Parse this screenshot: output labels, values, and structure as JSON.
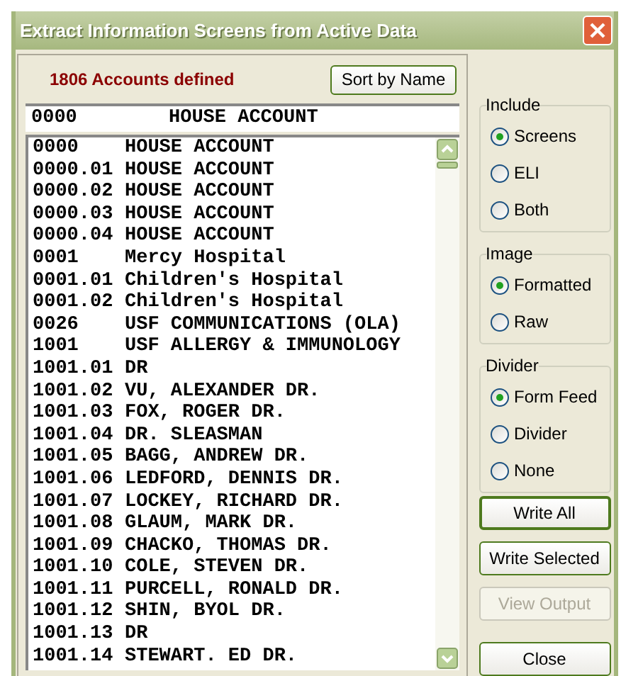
{
  "window": {
    "title": "Extract Information Screens from Active Data"
  },
  "header": {
    "count_text": "1806 Accounts defined",
    "sort_button": "Sort by Name"
  },
  "selected_account": {
    "code": "0000",
    "name": "HOUSE ACCOUNT"
  },
  "accounts": [
    {
      "code": "0000",
      "name": "HOUSE ACCOUNT"
    },
    {
      "code": "0000.01",
      "name": "HOUSE ACCOUNT"
    },
    {
      "code": "0000.02",
      "name": "HOUSE ACCOUNT"
    },
    {
      "code": "0000.03",
      "name": "HOUSE ACCOUNT"
    },
    {
      "code": "0000.04",
      "name": "HOUSE ACCOUNT"
    },
    {
      "code": "0001",
      "name": "Mercy Hospital"
    },
    {
      "code": "0001.01",
      "name": "Children's Hospital"
    },
    {
      "code": "0001.02",
      "name": "Children's Hospital"
    },
    {
      "code": "0026",
      "name": "USF COMMUNICATIONS (OLA)"
    },
    {
      "code": "1001",
      "name": "USF ALLERGY & IMMUNOLOGY"
    },
    {
      "code": "1001.01",
      "name": "DR"
    },
    {
      "code": "1001.02",
      "name": "VU, ALEXANDER DR."
    },
    {
      "code": "1001.03",
      "name": "FOX, ROGER DR."
    },
    {
      "code": "1001.04",
      "name": "DR. SLEASMAN"
    },
    {
      "code": "1001.05",
      "name": "BAGG, ANDREW DR."
    },
    {
      "code": "1001.06",
      "name": "LEDFORD, DENNIS DR."
    },
    {
      "code": "1001.07",
      "name": "LOCKEY, RICHARD DR."
    },
    {
      "code": "1001.08",
      "name": "GLAUM, MARK DR."
    },
    {
      "code": "1001.09",
      "name": "CHACKO, THOMAS DR."
    },
    {
      "code": "1001.10",
      "name": "COLE, STEVEN DR."
    },
    {
      "code": "1001.11",
      "name": "PURCELL, RONALD DR."
    },
    {
      "code": "1001.12",
      "name": "SHIN, BYOL DR."
    },
    {
      "code": "1001.13",
      "name": "DR"
    },
    {
      "code": "1001.14",
      "name": "STEWART. ED DR."
    }
  ],
  "groups": [
    {
      "title": "Include",
      "options": [
        {
          "label": "Screens",
          "selected": true
        },
        {
          "label": "ELI",
          "selected": false
        },
        {
          "label": "Both",
          "selected": false
        }
      ]
    },
    {
      "title": "Image",
      "options": [
        {
          "label": "Formatted",
          "selected": true
        },
        {
          "label": "Raw",
          "selected": false
        }
      ]
    },
    {
      "title": "Divider",
      "options": [
        {
          "label": "Form Feed",
          "selected": true
        },
        {
          "label": "Divider",
          "selected": false
        },
        {
          "label": "None",
          "selected": false
        }
      ]
    }
  ],
  "buttons": [
    {
      "label": "Write All",
      "default": true,
      "disabled": false
    },
    {
      "label": "Write Selected",
      "default": false,
      "disabled": false
    },
    {
      "label": "View Output",
      "default": false,
      "disabled": true
    },
    {
      "label": "Close",
      "default": false,
      "disabled": false
    }
  ]
}
